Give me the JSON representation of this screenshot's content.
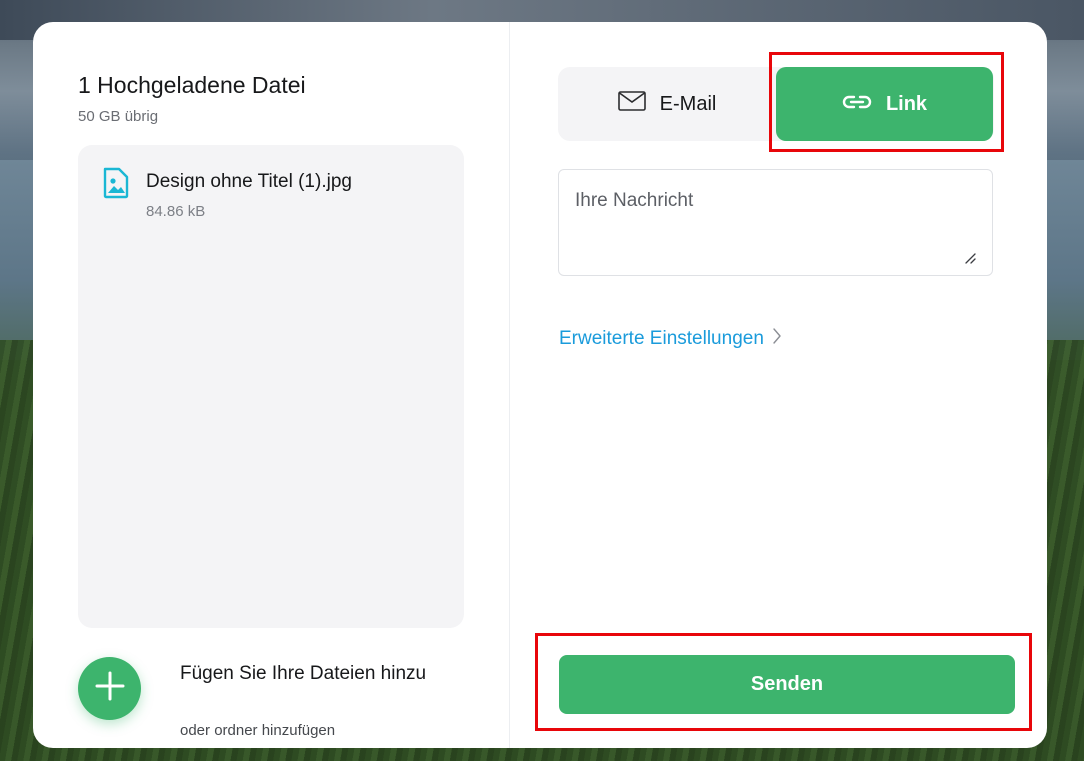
{
  "upload_panel": {
    "title": "1 Hochgeladene Datei",
    "storage_left": "50 GB übrig",
    "files": [
      {
        "name": "Design ohne Titel (1).jpg",
        "size": "84.86 kB",
        "icon": "image-file-icon"
      }
    ],
    "add_files_label": "Fügen Sie Ihre Dateien hinzu",
    "add_folder_label": "oder ordner hinzufügen",
    "add_icon": "plus-icon"
  },
  "send_panel": {
    "tabs": [
      {
        "label": "E-Mail",
        "icon": "envelope-icon",
        "active": false
      },
      {
        "label": "Link",
        "icon": "link-icon",
        "active": true
      }
    ],
    "message_placeholder": "Ihre Nachricht",
    "advanced_settings_label": "Erweiterte Einstellungen",
    "send_label": "Senden"
  },
  "colors": {
    "accent_green": "#3db46d",
    "link_blue": "#1a9bdb",
    "highlight_red": "#e8060a"
  }
}
